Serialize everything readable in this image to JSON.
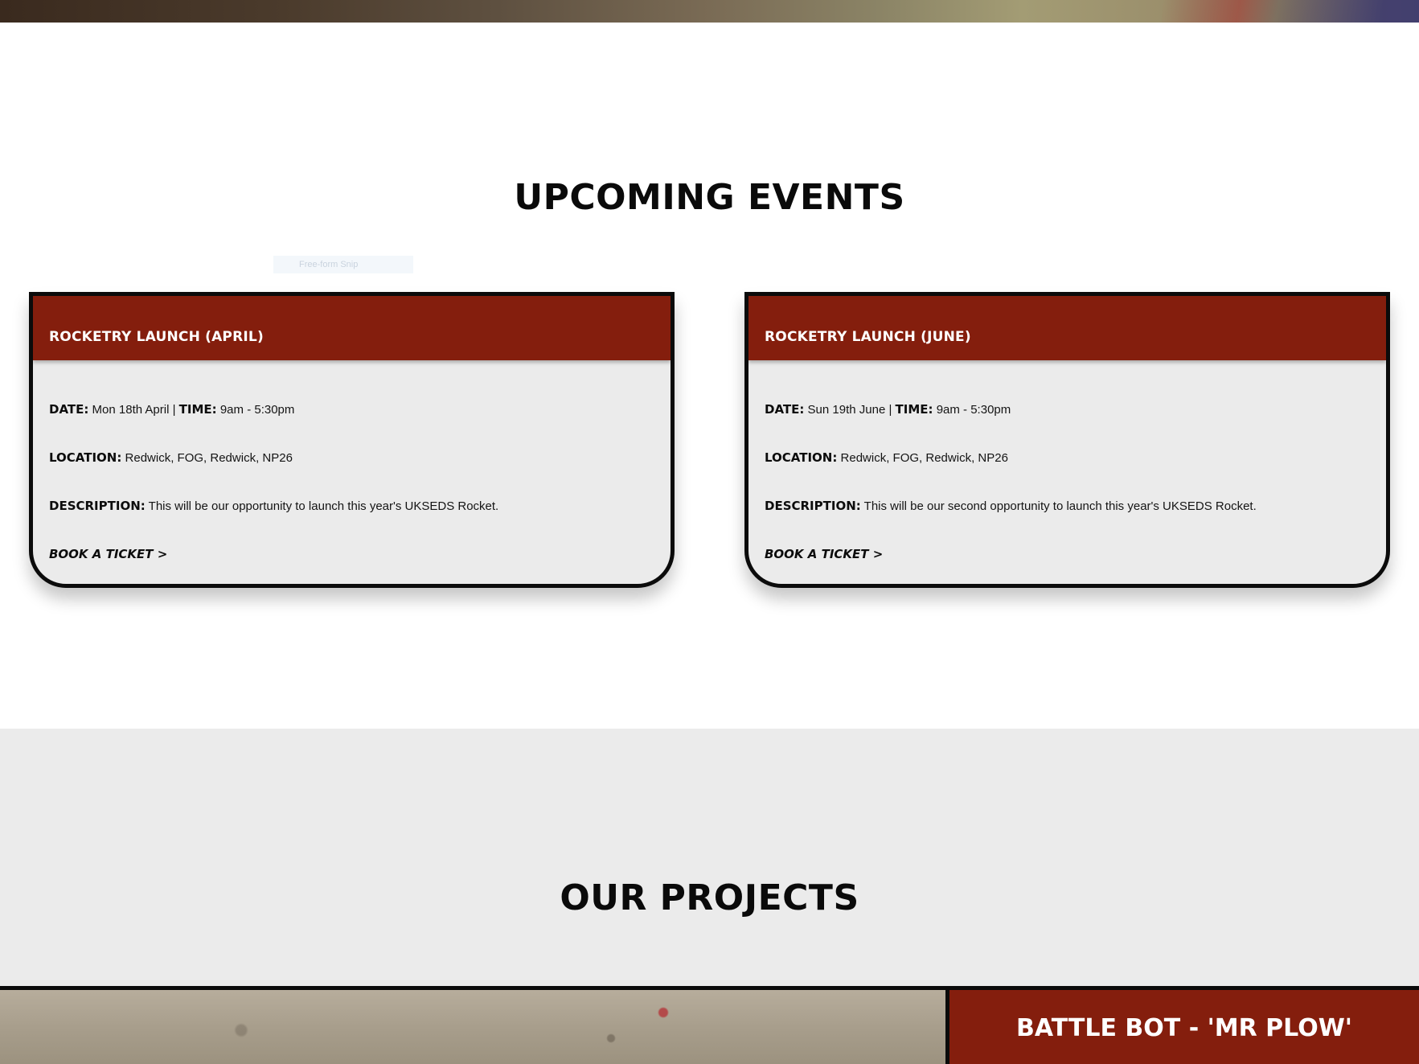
{
  "events": {
    "title": "UPCOMING EVENTS",
    "snip_overlay": "Free-form Snip",
    "cards": [
      {
        "title": "ROCKETRY LAUNCH (APRIL)",
        "date_label": "DATE:",
        "date_value": "Mon 18th April |",
        "time_label": "TIME:",
        "time_value": "9am - 5:30pm",
        "location_label": "LOCATION:",
        "location_value": "Redwick, FOG, Redwick, NP26",
        "description_label": "DESCRIPTION:",
        "description_value": "This will be our opportunity to launch this year's UKSEDS Rocket.",
        "book_label": "BOOK A TICKET >"
      },
      {
        "title": "ROCKETRY LAUNCH (JUNE)",
        "date_label": "DATE:",
        "date_value": "Sun 19th June |",
        "time_label": "TIME:",
        "time_value": "9am - 5:30pm",
        "location_label": "LOCATION:",
        "location_value": "Redwick, FOG, Redwick, NP26",
        "description_label": "DESCRIPTION:",
        "description_value": "This will be our second opportunity to launch this year's UKSEDS Rocket.",
        "book_label": "BOOK A TICKET >"
      }
    ]
  },
  "projects": {
    "title": "OUR PROJECTS",
    "featured": {
      "name": "BATTLE BOT - 'MR PLOW'"
    }
  },
  "colors": {
    "accent": "#841e0d",
    "card_background": "#ebebeb",
    "border": "#0b0b0b",
    "projects_background": "#ebebeb"
  }
}
